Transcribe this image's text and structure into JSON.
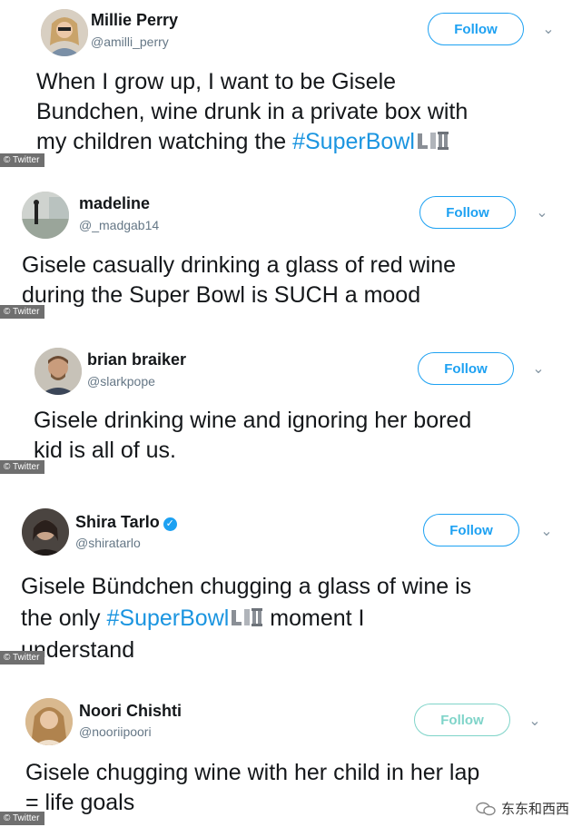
{
  "tweets": [
    {
      "name": "Millie Perry",
      "handle": "@amilli_perry",
      "follow_label": "Follow",
      "lines": [
        "When I grow up, I want to be Gisele",
        "Bundchen, wine drunk in a private box with",
        "my children watching the "
      ],
      "hashtag": "#SuperBowl",
      "credit": "© Twitter"
    },
    {
      "name": "madeline",
      "handle": "@_madgab14",
      "follow_label": "Follow",
      "lines": [
        "Gisele casually drinking a glass of red wine",
        "during the Super Bowl is SUCH a mood"
      ],
      "credit": "© Twitter"
    },
    {
      "name": "brian braiker",
      "handle": "@slarkpope",
      "follow_label": "Follow",
      "lines": [
        "Gisele drinking wine and ignoring her bored",
        "kid is all of us."
      ],
      "credit": "© Twitter"
    },
    {
      "name": "Shira Tarlo",
      "handle": "@shiratarlo",
      "follow_label": "Follow",
      "lines": [
        "Gisele Bündchen chugging a glass of wine is",
        "the only ",
        "understand"
      ],
      "hashtag": "#SuperBowl",
      "after_hashtag": " moment I",
      "credit": "© Twitter"
    },
    {
      "name": "Noori Chishti",
      "handle": "@nooriipoori",
      "follow_label": "Follow",
      "lines": [
        "Gisele chugging wine with her child in her lap",
        "= life goals"
      ],
      "credit": "© Twitter"
    }
  ],
  "watermark": "东东和西西",
  "colors": {
    "accent": "#1da1f2",
    "hashtag": "#1b95e0",
    "faded_follow": "#7fd4c9",
    "handle": "#657786"
  }
}
